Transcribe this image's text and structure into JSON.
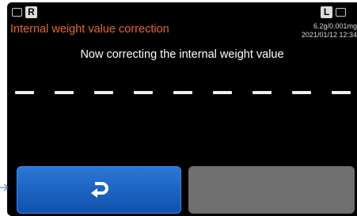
{
  "header": {
    "left_indicator": "R",
    "right_indicator": "L",
    "title": "Internal weight value correction",
    "capacity": "6.2g/0.001mg",
    "datetime": "2021/01/12 12:34"
  },
  "message": "Now correcting the internal weight value",
  "progress": {
    "segments": 9
  },
  "buttons": {
    "back_icon": "return-arrow-icon",
    "right_disabled": true
  },
  "colors": {
    "title": "#e8662a",
    "back_button": "#1f64c4",
    "disabled_button": "#6f6f6f",
    "background": "#000000"
  }
}
